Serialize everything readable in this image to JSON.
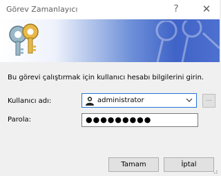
{
  "window": {
    "title": "Görev Zamanlayıcı",
    "help_glyph": "?",
    "close_glyph": "✕"
  },
  "banner": {
    "icon": "keys-icon",
    "watermark_icon": "keys-watermark-icon"
  },
  "form": {
    "instruction": "Bu görevi çalıştırmak için kullanıcı hesabı bilgilerini girin.",
    "username_label": "Kullanıcı adı:",
    "username_value": "administrator",
    "browse_label": "...",
    "password_label": "Parola:",
    "password_mask": "●●●●●●●●●"
  },
  "buttons": {
    "ok": "Tamam",
    "cancel": "İptal"
  },
  "colors": {
    "focus_border": "#1f73d6",
    "banner_blue": "#3f63c7"
  }
}
